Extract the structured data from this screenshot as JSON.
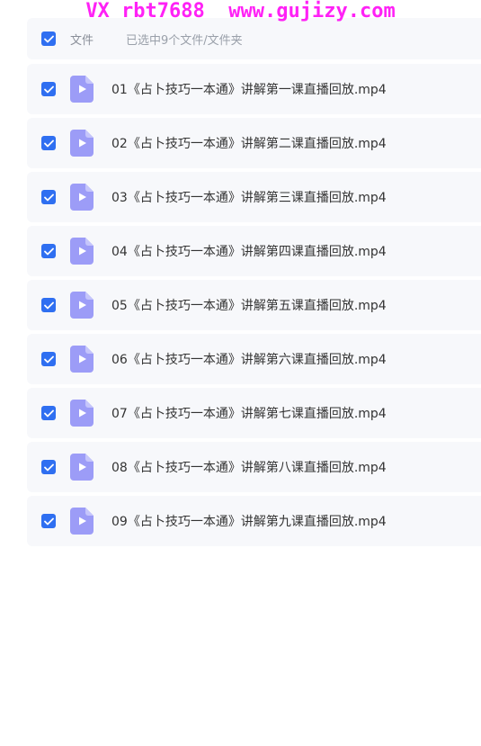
{
  "watermark": "VX rbt7688  www.gujizy.com",
  "header": {
    "column_label": "文件",
    "selection_status": "已选中9个文件/文件夹"
  },
  "colors": {
    "checkbox": "#2f6ff1",
    "file_icon": "#9c9cf7",
    "watermark": "#ff21f6"
  },
  "files": [
    {
      "name": "01《占卜技巧一本通》讲解第一课直播回放.mp4",
      "checked": true,
      "icon": "video-file-icon"
    },
    {
      "name": "02《占卜技巧一本通》讲解第二课直播回放.mp4",
      "checked": true,
      "icon": "video-file-icon"
    },
    {
      "name": "03《占卜技巧一本通》讲解第三课直播回放.mp4",
      "checked": true,
      "icon": "video-file-icon"
    },
    {
      "name": "04《占卜技巧一本通》讲解第四课直播回放.mp4",
      "checked": true,
      "icon": "video-file-icon"
    },
    {
      "name": "05《占卜技巧一本通》讲解第五课直播回放.mp4",
      "checked": true,
      "icon": "video-file-icon"
    },
    {
      "name": "06《占卜技巧一本通》讲解第六课直播回放.mp4",
      "checked": true,
      "icon": "video-file-icon"
    },
    {
      "name": "07《占卜技巧一本通》讲解第七课直播回放.mp4",
      "checked": true,
      "icon": "video-file-icon"
    },
    {
      "name": "08《占卜技巧一本通》讲解第八课直播回放.mp4",
      "checked": true,
      "icon": "video-file-icon"
    },
    {
      "name": "09《占卜技巧一本通》讲解第九课直播回放.mp4",
      "checked": true,
      "icon": "video-file-icon"
    }
  ]
}
